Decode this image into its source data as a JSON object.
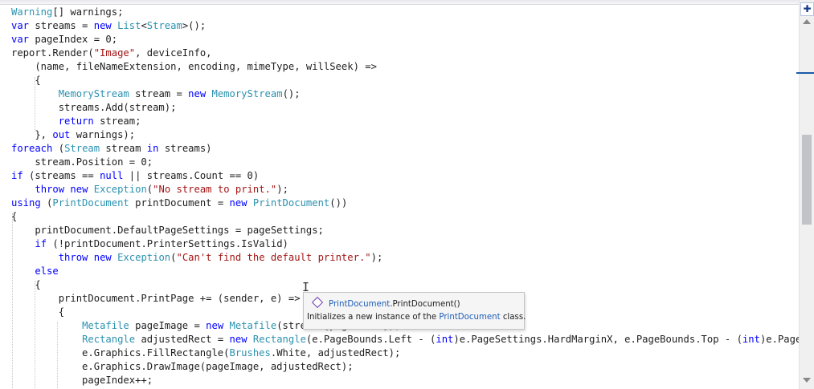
{
  "code": {
    "lines": [
      [
        "Warning",
        "[] warnings;"
      ],
      [
        "var",
        " streams = ",
        "new",
        " ",
        "List",
        "<",
        "Stream",
        ">();"
      ],
      [
        "var",
        " pageIndex = 0;"
      ],
      [
        "report.Render(",
        "\"Image\"",
        ", deviceInfo,"
      ],
      [
        "    (name, fileNameExtension, encoding, mimeType, willSeek) =>"
      ],
      [
        "    {"
      ],
      [
        "        ",
        "MemoryStream",
        " stream = ",
        "new",
        " ",
        "MemoryStream",
        "();"
      ],
      [
        "        streams.Add(stream);"
      ],
      [
        "        ",
        "return",
        " stream;"
      ],
      [
        "    }, ",
        "out",
        " warnings);"
      ],
      [
        "foreach",
        " (",
        "Stream",
        " stream ",
        "in",
        " streams)"
      ],
      [
        "    stream.Position = 0;"
      ],
      [
        "if",
        " (streams == ",
        "null",
        " || streams.Count == 0)"
      ],
      [
        "    ",
        "throw",
        " ",
        "new",
        " ",
        "Exception",
        "(",
        "\"No stream to print.\"",
        ");"
      ],
      [
        "using",
        " (",
        "PrintDocument",
        " printDocument = ",
        "new",
        " ",
        "PrintDocument",
        "())"
      ],
      [
        "{"
      ],
      [
        "    printDocument.DefaultPageSettings = pageSettings;"
      ],
      [
        "    ",
        "if",
        " (!printDocument.PrinterSettings.IsValid)"
      ],
      [
        "        ",
        "throw",
        " ",
        "new",
        " ",
        "Exception",
        "(",
        "\"Can't find the default printer.\"",
        ");"
      ],
      [
        "    ",
        "else"
      ],
      [
        "    {"
      ],
      [
        "        printDocument.PrintPage += (sender, e) =>"
      ],
      [
        "        {"
      ],
      [
        "            ",
        "Metafile",
        " pageImage = ",
        "new",
        " ",
        "Metafile",
        "(streams[pageIndex]);"
      ],
      [
        "            ",
        "Rectangle",
        " adjustedRect = ",
        "new",
        " ",
        "Rectangle",
        "(e.PageBounds.Left - (",
        "int",
        ")e.PageSettings.HardMarginX, e.PageBounds.Top - (",
        "int",
        ")e.PageSett"
      ],
      [
        "            e.Graphics.FillRectangle(",
        "Brushes",
        ".White, adjustedRect);"
      ],
      [
        "            e.Graphics.DrawImage(pageImage, adjustedRect);"
      ],
      [
        "            pageIndex++;"
      ]
    ]
  },
  "tooltip": {
    "icon": "method-icon",
    "signature_type": "PrintDocument",
    "signature_rest": ".PrintDocument()",
    "description_pre": "Initializes a new instance of the ",
    "description_link": "PrintDocument",
    "description_post": " class."
  },
  "scrollbar": {
    "split_glyph": "✚"
  },
  "colors": {
    "keyword": "#0000ff",
    "type": "#2b91af",
    "string": "#a31515",
    "text": "#1e1e1e",
    "link": "#1f5eb8"
  }
}
